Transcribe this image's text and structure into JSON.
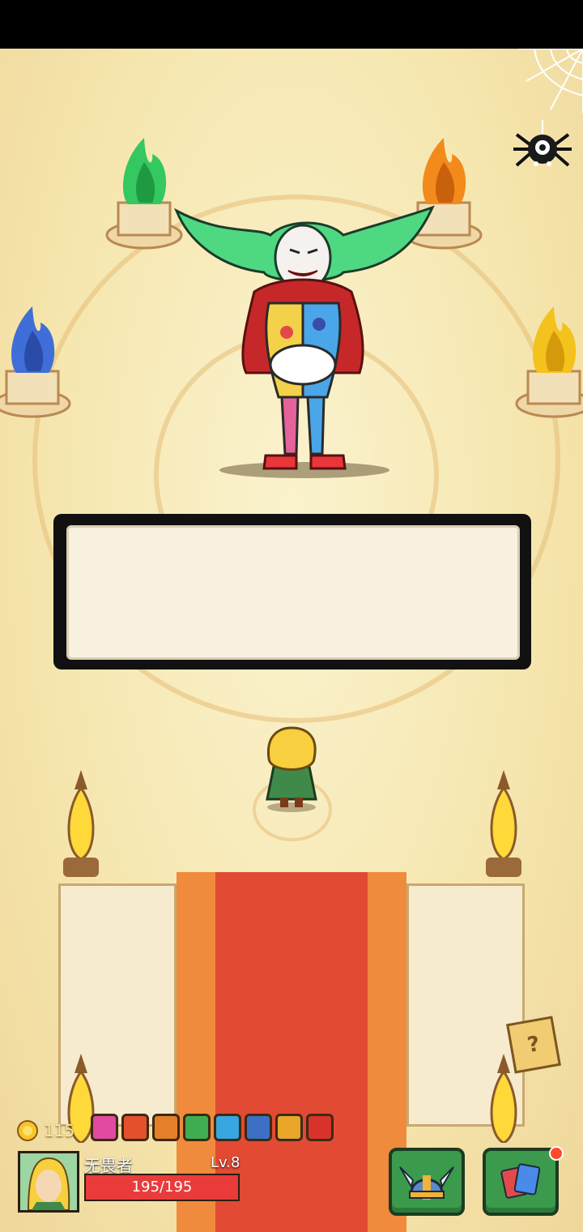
{
  "hud": {
    "gold": "115",
    "player_name": "无畏者",
    "level": "Lv.8",
    "hp_text": "195/195",
    "hp_fraction": 1.0
  },
  "dialog": {
    "text": ""
  },
  "help_card": {
    "label": "?"
  },
  "status_icons": [
    {
      "name": "demon-face-icon",
      "color": "#e14aa0"
    },
    {
      "name": "red-shield-icon",
      "color": "#e4502e"
    },
    {
      "name": "orange-sun-icon",
      "color": "#e57f2a"
    },
    {
      "name": "green-circuit-icon",
      "color": "#3fae52"
    },
    {
      "name": "blue-crystal-icon",
      "color": "#38a6e0"
    },
    {
      "name": "blue-creature-icon",
      "color": "#3d6fc4"
    },
    {
      "name": "gold-medal-icon",
      "color": "#e9a628"
    },
    {
      "name": "red-boxing-glove-icon",
      "color": "#d8332a"
    }
  ],
  "buttons": {
    "equipment": {
      "icon": "viking-helmet-icon"
    },
    "cards": {
      "icon": "card-deck-icon",
      "has_notification": true
    }
  },
  "colors": {
    "hp_fill": "#ea3b3b",
    "button_green": "#3c9a4c",
    "carpet": "#e24a33"
  }
}
